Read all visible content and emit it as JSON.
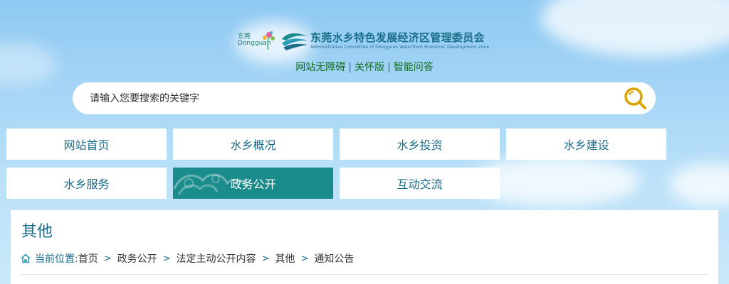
{
  "header": {
    "org_name_cn": "东莞水乡特色发展经济区管理委员会",
    "org_name_en": "Administrative Committee of Dongguan Waterfront Economic Development Zone",
    "city_logo_cn": "东莞",
    "city_logo_en": "Dongguan"
  },
  "quick_links": {
    "accessibility": "网站无障碍",
    "care_mode": "关怀版",
    "smart_qa": "智能问答",
    "separator": "|"
  },
  "search": {
    "placeholder": "请输入您要搜索的关键字"
  },
  "nav": {
    "items": [
      {
        "label": "网站首页"
      },
      {
        "label": "水乡概况"
      },
      {
        "label": "水乡投资"
      },
      {
        "label": "水乡建设"
      },
      {
        "label": "水乡服务"
      },
      {
        "label": "政务公开"
      },
      {
        "label": "互动交流"
      }
    ],
    "active_index": 5
  },
  "page": {
    "title": "其他",
    "breadcrumb_label": "当前位置:",
    "breadcrumb": [
      "首页",
      "政务公开",
      "法定主动公开内容",
      "其他",
      "通知公告"
    ],
    "separator": ">"
  },
  "colors": {
    "brand_teal": "#1b8c8c",
    "link_green": "#0f6c1e",
    "text_blue": "#1a6d8a",
    "search_icon": "#d9a400"
  }
}
